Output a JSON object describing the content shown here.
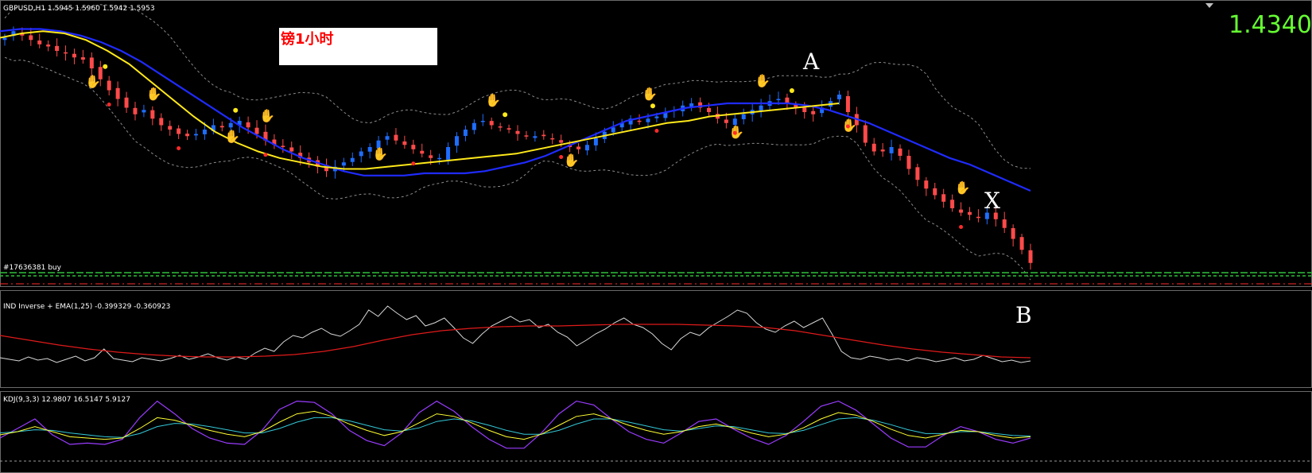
{
  "main_panel": {
    "header": "GBPUSD,H1  1.5945 1.5960 1.5942 1.5953",
    "current_price": "1.4340",
    "annotation_box": "镑1小时",
    "order_label": "#17636381 buy",
    "wave_labels": [
      "A",
      "X",
      "B"
    ]
  },
  "panel2": {
    "header": "IND Inverse + EMA(1,25) -0.399329 -0.360923"
  },
  "panel3": {
    "header": "KDJ(9,3,3) 12.9807 16.5147 5.9127"
  },
  "colors": {
    "background": "#000000",
    "up_candle": "#1f6dff",
    "down_candle": "#ff4a4a",
    "ma_slow": "#1f2bff",
    "ma_fast": "#ffe91a",
    "bands": "#8a8a8a",
    "price_label": "#66ff33",
    "ind_line": "#d8d8d8",
    "ind_ema": "#e01a1a",
    "kdj_k": "#ffff33",
    "kdj_d": "#33c8d8",
    "kdj_j": "#9a3cff"
  },
  "chart_data": {
    "type": "candlestick",
    "symbol": "GBPUSD",
    "timeframe": "H1",
    "candles": {
      "count": 112,
      "close_path": [
        1.6,
        1.603,
        1.601,
        1.599,
        1.597,
        1.596,
        1.594,
        1.593,
        1.591,
        1.59,
        1.586,
        1.581,
        1.576,
        1.572,
        1.568,
        1.565,
        1.567,
        1.563,
        1.56,
        1.558,
        1.556,
        1.555,
        1.556,
        1.558,
        1.56,
        1.559,
        1.561,
        1.562,
        1.559,
        1.556,
        1.553,
        1.551,
        1.55,
        1.548,
        1.545,
        1.543,
        1.541,
        1.539,
        1.541,
        1.543,
        1.545,
        1.548,
        1.55,
        1.553,
        1.555,
        1.553,
        1.551,
        1.549,
        1.547,
        1.545,
        1.545,
        1.55,
        1.555,
        1.558,
        1.561,
        1.562,
        1.56,
        1.559,
        1.558,
        1.556,
        1.555,
        1.555,
        1.555,
        1.554,
        1.552,
        1.55,
        1.549,
        1.551,
        1.554,
        1.557,
        1.559,
        1.561,
        1.563,
        1.562,
        1.563,
        1.564,
        1.566,
        1.567,
        1.569,
        1.57,
        1.568,
        1.566,
        1.563,
        1.561,
        1.563,
        1.565,
        1.567,
        1.569,
        1.571,
        1.572,
        1.57,
        1.568,
        1.566,
        1.565,
        1.568,
        1.571,
        1.574,
        1.566,
        1.56,
        1.552,
        1.548,
        1.548,
        1.55,
        1.546,
        1.54,
        1.535,
        1.531,
        1.528,
        1.525,
        1.522,
        1.52,
        1.519,
        1.518,
        1.52,
        1.517,
        1.513,
        1.508,
        1.503,
        1.497
      ]
    },
    "indicators": {
      "ma_slow_path": [
        1.603,
        1.604,
        1.604,
        1.603,
        1.601,
        1.598,
        1.594,
        1.589,
        1.583,
        1.577,
        1.571,
        1.565,
        1.559,
        1.554,
        1.549,
        1.545,
        1.542,
        1.539,
        1.537,
        1.537,
        1.537,
        1.538,
        1.538,
        1.538,
        1.539,
        1.541,
        1.543,
        1.546,
        1.55,
        1.554,
        1.558,
        1.562,
        1.564,
        1.566,
        1.568,
        1.569,
        1.57,
        1.57,
        1.57,
        1.57,
        1.569,
        1.567,
        1.564,
        1.561,
        1.557,
        1.553,
        1.549,
        1.545,
        1.542,
        1.538,
        1.534,
        1.53
      ],
      "ma_fast_path": [
        1.6,
        1.602,
        1.603,
        1.602,
        1.599,
        1.594,
        1.588,
        1.58,
        1.572,
        1.564,
        1.557,
        1.552,
        1.548,
        1.545,
        1.543,
        1.541,
        1.54,
        1.54,
        1.541,
        1.542,
        1.543,
        1.544,
        1.545,
        1.546,
        1.547,
        1.549,
        1.551,
        1.553,
        1.555,
        1.557,
        1.559,
        1.561,
        1.562,
        1.564,
        1.565,
        1.566,
        1.567,
        1.568,
        1.569,
        1.57
      ],
      "ind_line": [
        0.3,
        0.28,
        0.26,
        0.31,
        0.27,
        0.29,
        0.24,
        0.28,
        0.32,
        0.26,
        0.3,
        0.41,
        0.29,
        0.27,
        0.25,
        0.3,
        0.28,
        0.26,
        0.29,
        0.33,
        0.28,
        0.31,
        0.35,
        0.3,
        0.27,
        0.31,
        0.28,
        0.36,
        0.42,
        0.38,
        0.5,
        0.58,
        0.55,
        0.62,
        0.67,
        0.6,
        0.57,
        0.64,
        0.72,
        0.9,
        0.82,
        0.95,
        0.86,
        0.78,
        0.83,
        0.7,
        0.74,
        0.8,
        0.68,
        0.55,
        0.48,
        0.6,
        0.7,
        0.76,
        0.82,
        0.75,
        0.78,
        0.68,
        0.72,
        0.62,
        0.56,
        0.45,
        0.52,
        0.6,
        0.66,
        0.74,
        0.8,
        0.72,
        0.68,
        0.6,
        0.48,
        0.4,
        0.54,
        0.62,
        0.58,
        0.68,
        0.75,
        0.82,
        0.9,
        0.86,
        0.74,
        0.66,
        0.62,
        0.7,
        0.76,
        0.68,
        0.74,
        0.8,
        0.6,
        0.38,
        0.3,
        0.28,
        0.32,
        0.3,
        0.27,
        0.29,
        0.26,
        0.3,
        0.28,
        0.25,
        0.27,
        0.3,
        0.26,
        0.28,
        0.33,
        0.29,
        0.25,
        0.27,
        0.24,
        0.26
      ],
      "ind_ema": [
        0.58,
        0.52,
        0.46,
        0.41,
        0.37,
        0.34,
        0.32,
        0.31,
        0.31,
        0.32,
        0.34,
        0.38,
        0.44,
        0.52,
        0.59,
        0.64,
        0.67,
        0.69,
        0.7,
        0.7,
        0.71,
        0.72,
        0.72,
        0.72,
        0.71,
        0.7,
        0.68,
        0.64,
        0.58,
        0.52,
        0.46,
        0.41,
        0.37,
        0.34,
        0.31,
        0.3
      ],
      "kdj_k": [
        0.45,
        0.5,
        0.58,
        0.5,
        0.42,
        0.4,
        0.38,
        0.4,
        0.55,
        0.72,
        0.68,
        0.6,
        0.52,
        0.46,
        0.42,
        0.5,
        0.65,
        0.78,
        0.82,
        0.74,
        0.62,
        0.52,
        0.44,
        0.5,
        0.64,
        0.78,
        0.74,
        0.64,
        0.52,
        0.42,
        0.38,
        0.46,
        0.6,
        0.74,
        0.78,
        0.7,
        0.6,
        0.52,
        0.46,
        0.5,
        0.58,
        0.62,
        0.56,
        0.48,
        0.42,
        0.46,
        0.56,
        0.7,
        0.8,
        0.76,
        0.66,
        0.54,
        0.44,
        0.4,
        0.46,
        0.52,
        0.5,
        0.44,
        0.4,
        0.42
      ],
      "kdj_d": [
        0.48,
        0.5,
        0.53,
        0.52,
        0.48,
        0.45,
        0.42,
        0.41,
        0.47,
        0.58,
        0.63,
        0.62,
        0.58,
        0.53,
        0.48,
        0.48,
        0.55,
        0.65,
        0.72,
        0.72,
        0.67,
        0.6,
        0.53,
        0.51,
        0.56,
        0.66,
        0.7,
        0.67,
        0.6,
        0.52,
        0.46,
        0.46,
        0.52,
        0.62,
        0.7,
        0.7,
        0.65,
        0.59,
        0.53,
        0.51,
        0.55,
        0.59,
        0.58,
        0.53,
        0.48,
        0.47,
        0.52,
        0.61,
        0.7,
        0.72,
        0.68,
        0.61,
        0.53,
        0.47,
        0.47,
        0.5,
        0.5,
        0.47,
        0.44,
        0.43
      ],
      "kdj_j": [
        0.4,
        0.55,
        0.7,
        0.45,
        0.3,
        0.32,
        0.3,
        0.38,
        0.72,
        0.98,
        0.78,
        0.55,
        0.4,
        0.32,
        0.3,
        0.52,
        0.85,
        0.98,
        0.96,
        0.78,
        0.52,
        0.36,
        0.28,
        0.48,
        0.8,
        0.98,
        0.82,
        0.58,
        0.38,
        0.24,
        0.24,
        0.48,
        0.78,
        0.98,
        0.92,
        0.7,
        0.5,
        0.38,
        0.32,
        0.48,
        0.66,
        0.7,
        0.54,
        0.4,
        0.3,
        0.44,
        0.66,
        0.9,
        0.98,
        0.84,
        0.62,
        0.4,
        0.26,
        0.26,
        0.44,
        0.58,
        0.5,
        0.38,
        0.32,
        0.4
      ]
    }
  }
}
